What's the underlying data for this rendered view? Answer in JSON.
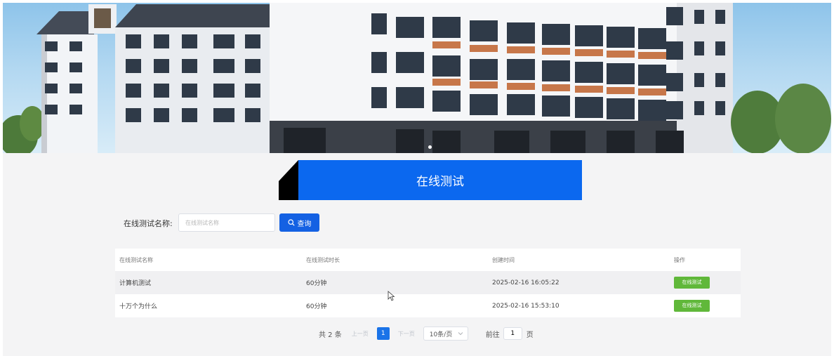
{
  "banner": {
    "active_slide": 1,
    "slide_count": 1
  },
  "section": {
    "title": "在线测试"
  },
  "search": {
    "label": "在线测试名称:",
    "placeholder": "在线测试名称",
    "button_label": "查询",
    "icon": "search-icon"
  },
  "table": {
    "headers": [
      "在线测试名称",
      "在线测试时长",
      "创建时间",
      "操作"
    ],
    "rows": [
      {
        "name": "计算机测试",
        "duration": "60分钟",
        "created": "2025-02-16 16:05:22",
        "action": "在线测试"
      },
      {
        "name": "十万个为什么",
        "duration": "60分钟",
        "created": "2025-02-16 15:53:10",
        "action": "在线测试"
      }
    ]
  },
  "pagination": {
    "total": "共 2 条",
    "prev": "上一页",
    "current_page": "1",
    "next": "下一页",
    "page_size": "10条/页",
    "goto_prefix": "前往",
    "goto_value": "1",
    "goto_suffix": "页"
  },
  "colors": {
    "accent": "#0b68ef",
    "action": "#60b83a"
  }
}
